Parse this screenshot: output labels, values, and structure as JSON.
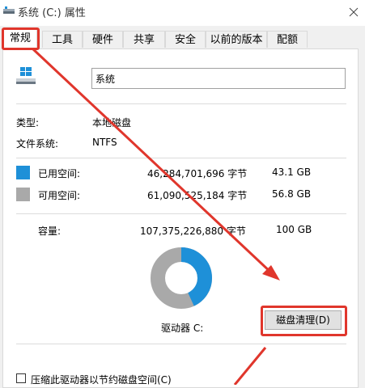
{
  "window": {
    "title": "系统 (C:) 属性"
  },
  "tabs": [
    {
      "label": "常规",
      "active": true
    },
    {
      "label": "工具"
    },
    {
      "label": "硬件"
    },
    {
      "label": "共享"
    },
    {
      "label": "安全"
    },
    {
      "label": "以前的版本"
    },
    {
      "label": "配额"
    }
  ],
  "general": {
    "drive_name_value": "系统",
    "type_label": "类型:",
    "type_value": "本地磁盘",
    "fs_label": "文件系统:",
    "fs_value": "NTFS",
    "used_label": "已用空间:",
    "used_bytes": "46,284,701,696 字节",
    "used_gb": "43.1 GB",
    "free_label": "可用空间:",
    "free_bytes": "61,090,525,184 字节",
    "free_gb": "56.8 GB",
    "capacity_label": "容量:",
    "capacity_bytes": "107,375,226,880 字节",
    "capacity_gb": "100 GB",
    "drive_caption": "驱动器 C:",
    "cleanup_button": "磁盘清理(D)",
    "compress_checkbox": "压缩此驱动器以节约磁盘空间(C)",
    "used_fraction": 0.431
  },
  "colors": {
    "used": "#1e90d8",
    "free": "#a9a9a9",
    "highlight": "#e0362c"
  }
}
